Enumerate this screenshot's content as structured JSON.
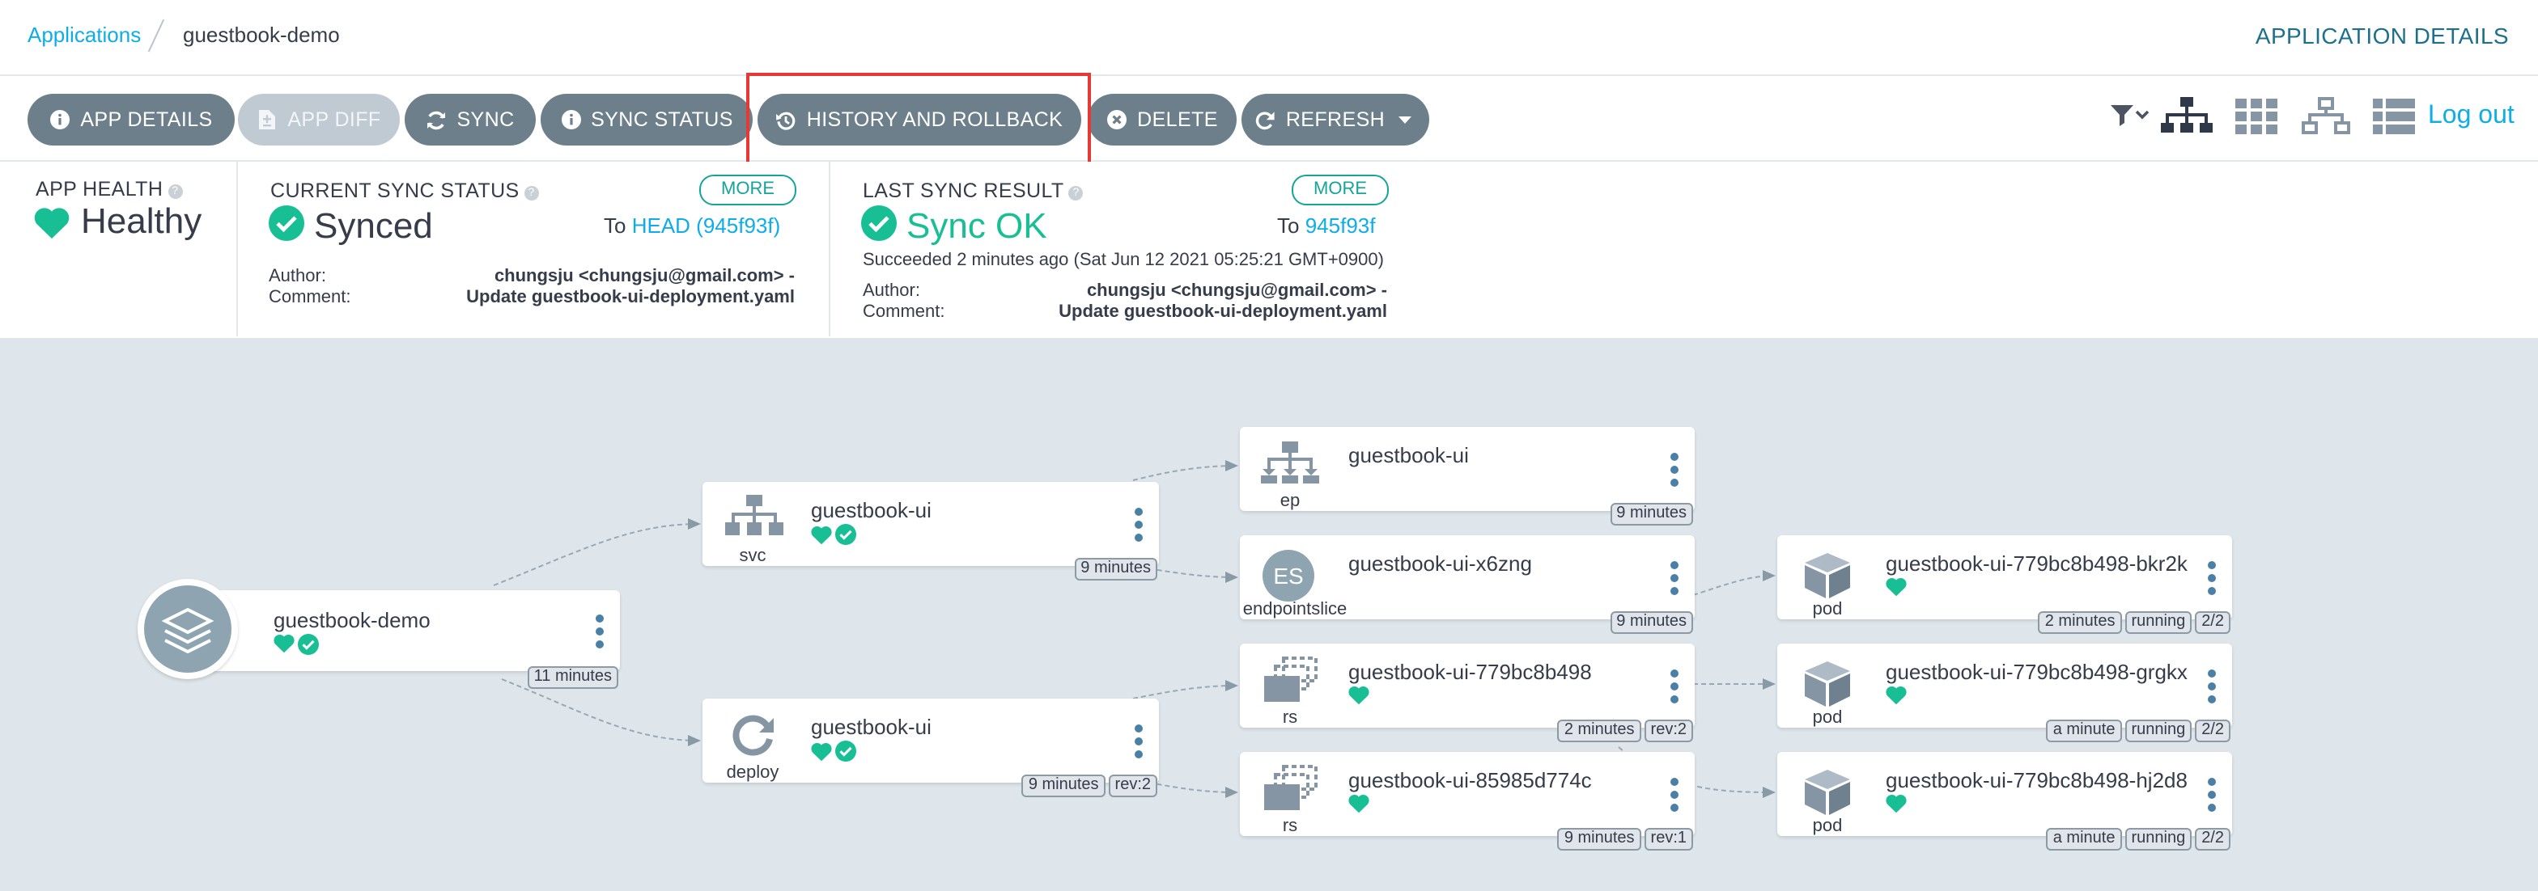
{
  "header": {
    "breadcrumb_root": "Applications",
    "breadcrumb_current": "guestbook-demo",
    "title": "APPLICATION DETAILS"
  },
  "toolbar": {
    "app_details": "APP DETAILS",
    "app_diff": "APP DIFF",
    "sync": "SYNC",
    "sync_status": "SYNC STATUS",
    "history": "HISTORY AND ROLLBACK",
    "delete": "DELETE",
    "refresh": "REFRESH",
    "logout": "Log out"
  },
  "summary": {
    "app_health_label": "APP HEALTH",
    "app_health_value": "Healthy",
    "current_sync_label": "CURRENT SYNC STATUS",
    "current_sync_value": "Synced",
    "more": "MORE",
    "to_prefix": "To",
    "current_revision": "HEAD (945f93f)",
    "author_label": "Author:",
    "comment_label": "Comment:",
    "author": "chungsju <chungsju@gmail.com> -",
    "comment": "Update guestbook-ui-deployment.yaml",
    "last_sync_label": "LAST SYNC RESULT",
    "last_sync_value": "Sync OK",
    "last_revision": "945f93f",
    "succeeded": "Succeeded 2 minutes ago (Sat Jun 12 2021 05:25:21 GMT+0900)"
  },
  "graph": {
    "app": {
      "name": "guestbook-demo",
      "age": "11 minutes"
    },
    "svc": {
      "name": "guestbook-ui",
      "kind": "svc",
      "age": "9 minutes"
    },
    "deploy": {
      "name": "guestbook-ui",
      "kind": "deploy",
      "age": "9 minutes",
      "rev": "rev:2"
    },
    "ep": {
      "name": "guestbook-ui",
      "kind": "ep",
      "age": "9 minutes"
    },
    "eps": {
      "name": "guestbook-ui-x6zng",
      "kind": "endpointslice",
      "badge": "ES",
      "age": "9 minutes"
    },
    "rs1": {
      "name": "guestbook-ui-779bc8b498",
      "kind": "rs",
      "age": "2 minutes",
      "rev": "rev:2"
    },
    "rs2": {
      "name": "guestbook-ui-85985d774c",
      "kind": "rs",
      "age": "9 minutes",
      "rev": "rev:1"
    },
    "pod1": {
      "name": "guestbook-ui-779bc8b498-bkr2k",
      "kind": "pod",
      "age": "2 minutes",
      "state": "running",
      "ready": "2/2"
    },
    "pod2": {
      "name": "guestbook-ui-779bc8b498-grgkx",
      "kind": "pod",
      "age": "a minute",
      "state": "running",
      "ready": "2/2"
    },
    "pod3": {
      "name": "guestbook-ui-779bc8b498-hj2d8",
      "kind": "pod",
      "age": "a minute",
      "state": "running",
      "ready": "2/2"
    }
  },
  "colors": {
    "healthy": "#18be94",
    "button": "#6d7f8b",
    "link": "#0dadea",
    "highlight": "#e53935"
  }
}
